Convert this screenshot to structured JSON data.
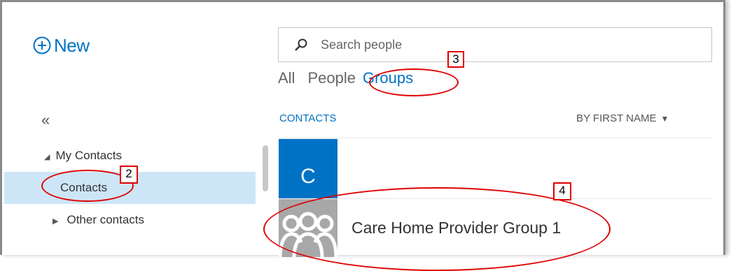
{
  "new_button": {
    "label": "New",
    "icon": "plus-circle-icon"
  },
  "search": {
    "placeholder": "Search people",
    "icon": "search-icon"
  },
  "filter_tabs": [
    {
      "label": "All",
      "active": false
    },
    {
      "label": "People",
      "active": false
    },
    {
      "label": "Groups",
      "active": true
    }
  ],
  "collapse": {
    "glyph": "«"
  },
  "list_header": {
    "title": "CONTACTS",
    "sort_label": "BY FIRST NAME",
    "sort_icon": "▼"
  },
  "sidebar": {
    "my_contacts": {
      "label": "My Contacts",
      "arrow": "◢"
    },
    "contacts": {
      "label": "Contacts"
    },
    "other_contacts": {
      "label": "Other contacts",
      "arrow": "▶"
    }
  },
  "list": {
    "letter": "C",
    "groups": [
      {
        "name": "Care Home Provider Group 1",
        "icon": "group-icon"
      }
    ]
  },
  "annotations": {
    "a2": "2",
    "a3": "3",
    "a4": "4"
  },
  "colors": {
    "accent": "#0072c6",
    "selected_bg": "#cde6f7",
    "annotation": "#e00000"
  }
}
